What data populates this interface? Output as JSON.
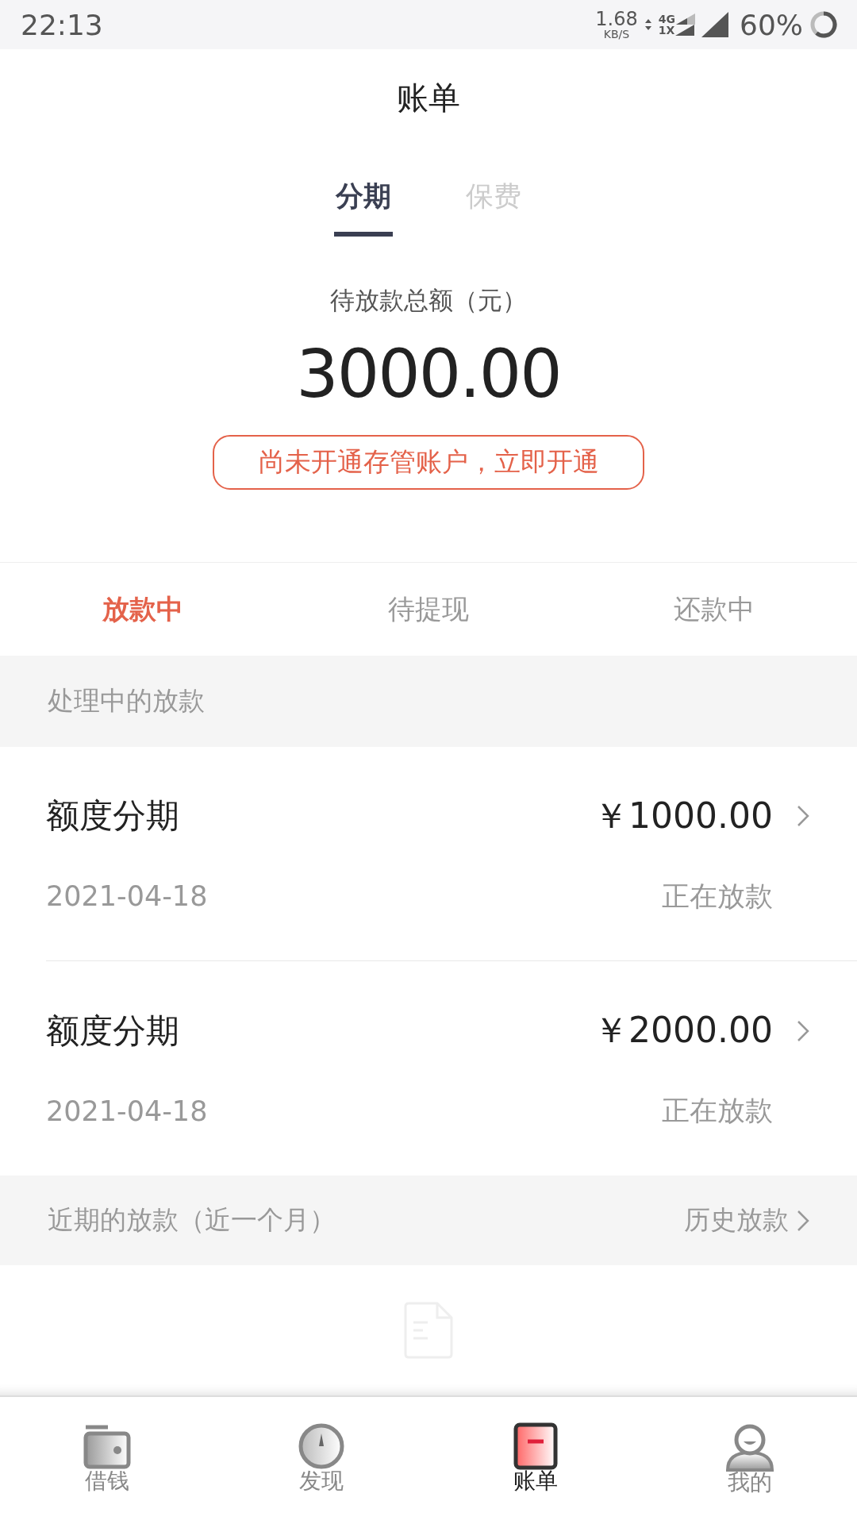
{
  "status_bar": {
    "time": "22:13",
    "speed": "1.68",
    "speed_unit": "KB/S",
    "net_top": "4G",
    "net_bottom": "1X",
    "battery": "60%"
  },
  "header": {
    "title": "账单"
  },
  "tabs": [
    {
      "label": "分期",
      "selected": true
    },
    {
      "label": "保费",
      "selected": false
    }
  ],
  "summary": {
    "label": "待放款总额（元）",
    "amount": "3000.00",
    "notice": "尚未开通存管账户，立即开通"
  },
  "sub_tabs": [
    {
      "label": "放款中",
      "selected": true
    },
    {
      "label": "待提现",
      "selected": false
    },
    {
      "label": "还款中",
      "selected": false
    }
  ],
  "processing": {
    "heading": "处理中的放款",
    "items": [
      {
        "title": "额度分期",
        "amount": "￥1000.00",
        "date": "2021-04-18",
        "status": "正在放款"
      },
      {
        "title": "额度分期",
        "amount": "￥2000.00",
        "date": "2021-04-18",
        "status": "正在放款"
      }
    ]
  },
  "recent": {
    "heading": "近期的放款（近一个月）",
    "link": "历史放款"
  },
  "bottom_nav": [
    {
      "label": "借钱",
      "kind": "wallet",
      "selected": false
    },
    {
      "label": "发现",
      "kind": "compass",
      "selected": false
    },
    {
      "label": "账单",
      "kind": "bill",
      "selected": true
    },
    {
      "label": "我的",
      "kind": "person",
      "selected": false
    }
  ]
}
